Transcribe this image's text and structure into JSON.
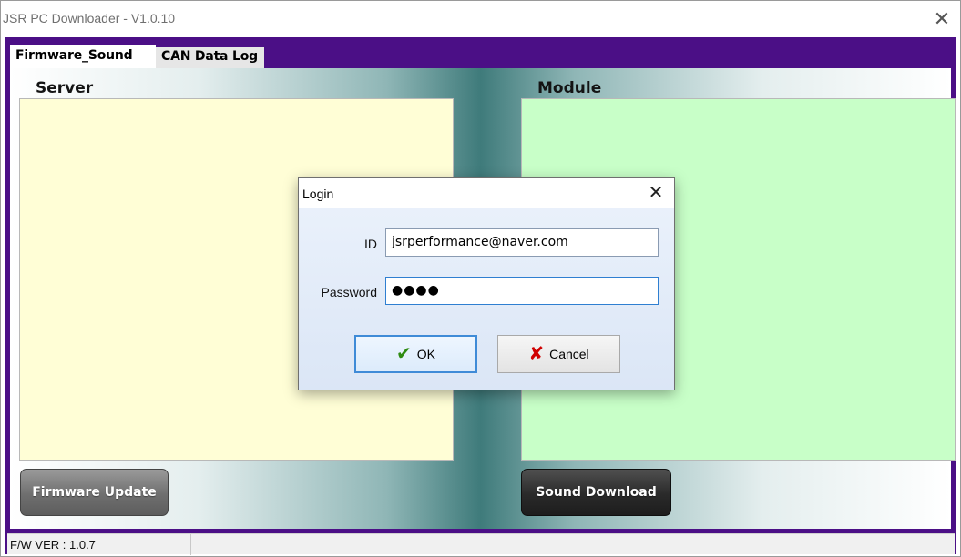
{
  "window": {
    "title": "JSR PC Downloader - V1.0.10",
    "close_glyph": "✕"
  },
  "tabs": [
    {
      "label": "Firmware_Sound",
      "active": true
    },
    {
      "label": "CAN Data Log",
      "active": false
    }
  ],
  "panels": {
    "server_label": "Server",
    "module_label": "Module",
    "server_color": "#fffed6",
    "module_color": "#c8ffc8"
  },
  "buttons": {
    "firmware_update": "Firmware Update",
    "sound_download": "Sound Download"
  },
  "statusbar": {
    "fw_version": "F/W VER : 1.0.7"
  },
  "login_dialog": {
    "title": "Login",
    "close_glyph": "✕",
    "id_label": "ID",
    "id_value": "jsrperformance@naver.com",
    "password_label": "Password",
    "password_value": "●●●●",
    "ok_label": "OK",
    "cancel_label": "Cancel",
    "ok_icon": "checkmark-icon",
    "cancel_icon": "x-icon"
  },
  "colors": {
    "frame_purple": "#4b0f86",
    "teal_center": "#3f7b7b"
  }
}
